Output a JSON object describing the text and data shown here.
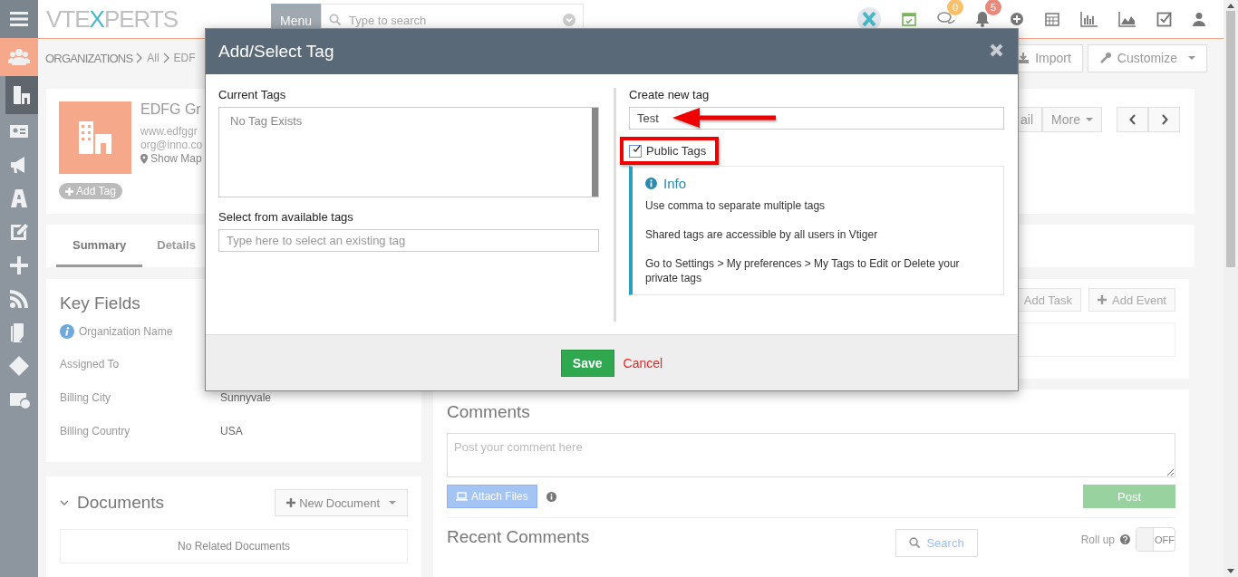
{
  "sidebar": {
    "items": [
      {
        "highlighted": false,
        "selected": false
      },
      {
        "highlighted": true,
        "selected": false
      },
      {
        "highlighted": false,
        "selected": true
      },
      {
        "highlighted": false,
        "selected": false
      },
      {
        "highlighted": false,
        "selected": false
      },
      {
        "highlighted": false,
        "selected": false
      },
      {
        "highlighted": false,
        "selected": false
      },
      {
        "highlighted": false,
        "selected": false
      },
      {
        "highlighted": false,
        "selected": false
      },
      {
        "highlighted": false,
        "selected": false
      },
      {
        "highlighted": false,
        "selected": false
      },
      {
        "highlighted": false,
        "selected": false
      }
    ]
  },
  "topbar": {
    "logo_parts": [
      "VTE",
      "X",
      "PERTS"
    ],
    "menu": "Menu",
    "search_placeholder": "Type to search",
    "messages_badge": "0",
    "alerts_badge": "5"
  },
  "breadcrumb": [
    "ORGANIZATIONS",
    "All",
    "EDF"
  ],
  "page_actions": [
    "Import",
    "Customize"
  ],
  "record": {
    "name": "EDFG Gr",
    "website": "www.edfggr",
    "email": "org@inno.co",
    "map_link": "Show Map",
    "add_tag": "Add Tag",
    "buttons": [
      "ail",
      "More"
    ]
  },
  "tabs": [
    {
      "label": "Summary",
      "selected": true
    },
    {
      "label": "Details",
      "selected": false
    }
  ],
  "key_fields": {
    "title": "Key Fields",
    "fields": [
      {
        "label": "Organization Name",
        "info": true
      },
      {
        "label": "Assigned To",
        "info": false
      },
      {
        "label": "Billing City",
        "value": "Sunnyvale",
        "info": false
      },
      {
        "label": "Billing Country",
        "value": "USA",
        "info": false
      }
    ]
  },
  "documents": {
    "title": "Documents",
    "new_button": "New Document",
    "empty": "No Related Documents"
  },
  "activities": {
    "buttons": [
      "Add Task",
      "Add Event"
    ]
  },
  "comments": {
    "title": "Comments",
    "placeholder": "Post your comment here",
    "attach": "Attach Files",
    "post": "Post"
  },
  "recent_comments": {
    "title": "Recent Comments",
    "search": "Search",
    "rollup": "Roll up",
    "toggle": {
      "label": "OFF",
      "on": false
    }
  },
  "modal": {
    "title": "Add/Select Tag",
    "current_tags_label": "Current Tags",
    "current_tags_empty": "No Tag Exists",
    "select_label": "Select from available tags",
    "select_placeholder": "Type here to select an existing tag",
    "create_label": "Create new tag",
    "create_value": "Test",
    "public_checkbox": {
      "label": "Public Tags",
      "checked": true
    },
    "info": {
      "title": "Info",
      "lines": [
        "Use comma to separate multiple tags",
        "Shared tags are accessible by all users in Vtiger",
        "Go to Settings > My preferences > My Tags to Edit or Delete your private tags"
      ]
    },
    "save": "Save",
    "cancel": "Cancel"
  }
}
